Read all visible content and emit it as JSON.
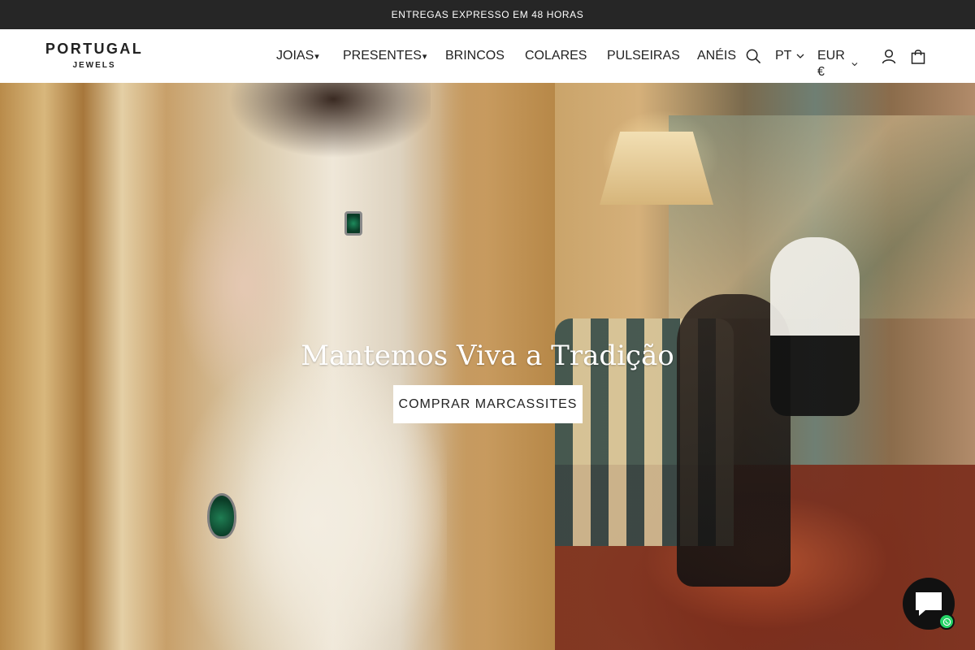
{
  "announcement": {
    "text": "ENTREGAS EXPRESSO EM 48 HORAS"
  },
  "brand": {
    "name": "PORTUGAL",
    "sub": "JEWELS"
  },
  "nav": {
    "items": [
      {
        "label": "JOIAS",
        "caret": "▾"
      },
      {
        "label": "PRESENTES",
        "caret": "▾"
      },
      {
        "label": "BRINCOS"
      },
      {
        "label": "COLARES"
      },
      {
        "label": "PULSEIRAS"
      },
      {
        "label": "ANÉIS"
      }
    ],
    "icons": {
      "search": "search-icon",
      "account": "user-icon",
      "cart": "shopping-bag-icon",
      "language_chevron": "chevron-down-icon",
      "currency_chevron": "chevron-down-icon"
    },
    "language": "PT",
    "currency": "EUR €"
  },
  "hero": {
    "title": "Mantemos Viva a Tradição",
    "cta": "COMPRAR MARCASSITES"
  },
  "chat": {
    "icon": "chat-bubble-icon",
    "badge_icon": "whatsapp-icon",
    "badge_color": "#25d366"
  },
  "colors": {
    "announcement_bg": "#262626",
    "text": "#222222",
    "header_bg": "#ffffff"
  }
}
